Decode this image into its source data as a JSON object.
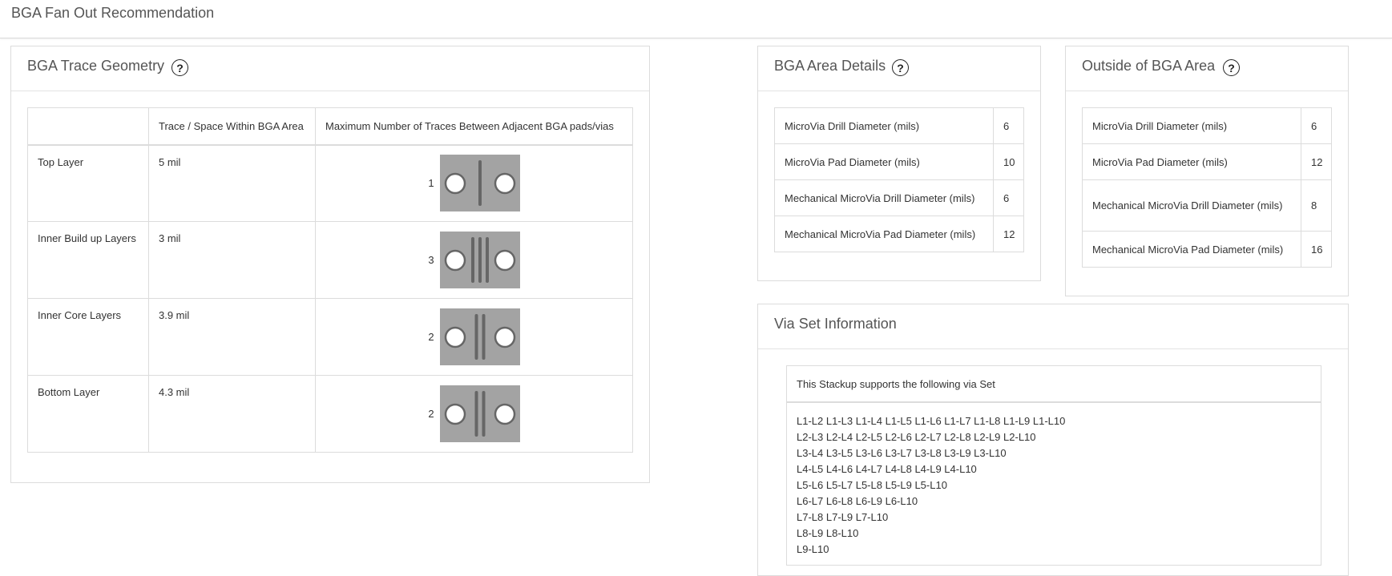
{
  "page": {
    "title": "BGA Fan Out Recommendation"
  },
  "trace_geometry": {
    "title": "BGA Trace Geometry",
    "headers": [
      "",
      "Trace / Space Within BGA Area",
      "Maximum Number of Traces Between Adjacent BGA pads/vias"
    ],
    "rows": [
      {
        "layer": "Top Layer",
        "trace_space": "5 mil",
        "max_traces": "1",
        "trace_count": 1
      },
      {
        "layer": "Inner Build up Layers",
        "trace_space": "3 mil",
        "max_traces": "3",
        "trace_count": 3
      },
      {
        "layer": "Inner Core Layers",
        "trace_space": "3.9 mil",
        "max_traces": "2",
        "trace_count": 2
      },
      {
        "layer": "Bottom Layer",
        "trace_space": "4.3 mil",
        "max_traces": "2",
        "trace_count": 2
      }
    ]
  },
  "bga_area": {
    "title": "BGA Area Details",
    "rows": [
      {
        "label": "MicroVia Drill Diameter (mils)",
        "value": "6"
      },
      {
        "label": "MicroVia Pad Diameter (mils)",
        "value": "10"
      },
      {
        "label": "Mechanical MicroVia Drill Diameter (mils)",
        "value": "6"
      },
      {
        "label": "Mechanical MicroVia Pad Diameter (mils)",
        "value": "12"
      }
    ]
  },
  "outside_bga": {
    "title": "Outside of BGA Area",
    "rows": [
      {
        "label": "MicroVia Drill Diameter (mils)",
        "value": "6"
      },
      {
        "label": "MicroVia Pad Diameter (mils)",
        "value": "12"
      },
      {
        "label": "Mechanical MicroVia Drill Diameter (mils)",
        "value": "8"
      },
      {
        "label": "Mechanical MicroVia Pad Diameter (mils)",
        "value": "16"
      }
    ]
  },
  "via_set": {
    "title": "Via Set Information",
    "header": "This Stackup supports the following via Set",
    "lines": [
      "L1-L2 L1-L3 L1-L4 L1-L5 L1-L6 L1-L7 L1-L8 L1-L9 L1-L10",
      "L2-L3 L2-L4 L2-L5 L2-L6 L2-L7 L2-L8 L2-L9 L2-L10",
      "L3-L4 L3-L5 L3-L6 L3-L7 L3-L8 L3-L9 L3-L10",
      "L4-L5 L4-L6 L4-L7 L4-L8 L4-L9 L4-L10",
      "L5-L6 L5-L7 L5-L8 L5-L9 L5-L10",
      "L6-L7 L6-L8 L6-L9 L6-L10",
      "L7-L8 L7-L9 L7-L10",
      "L8-L9 L8-L10",
      "L9-L10"
    ]
  },
  "icons": {
    "help": "help-question-icon"
  },
  "help_glyph": "?",
  "colors": {
    "diagram_bg": "#a3a3a3",
    "trace": "#666666",
    "pad_fill": "#ffffff",
    "pad_stroke": "#666666"
  }
}
